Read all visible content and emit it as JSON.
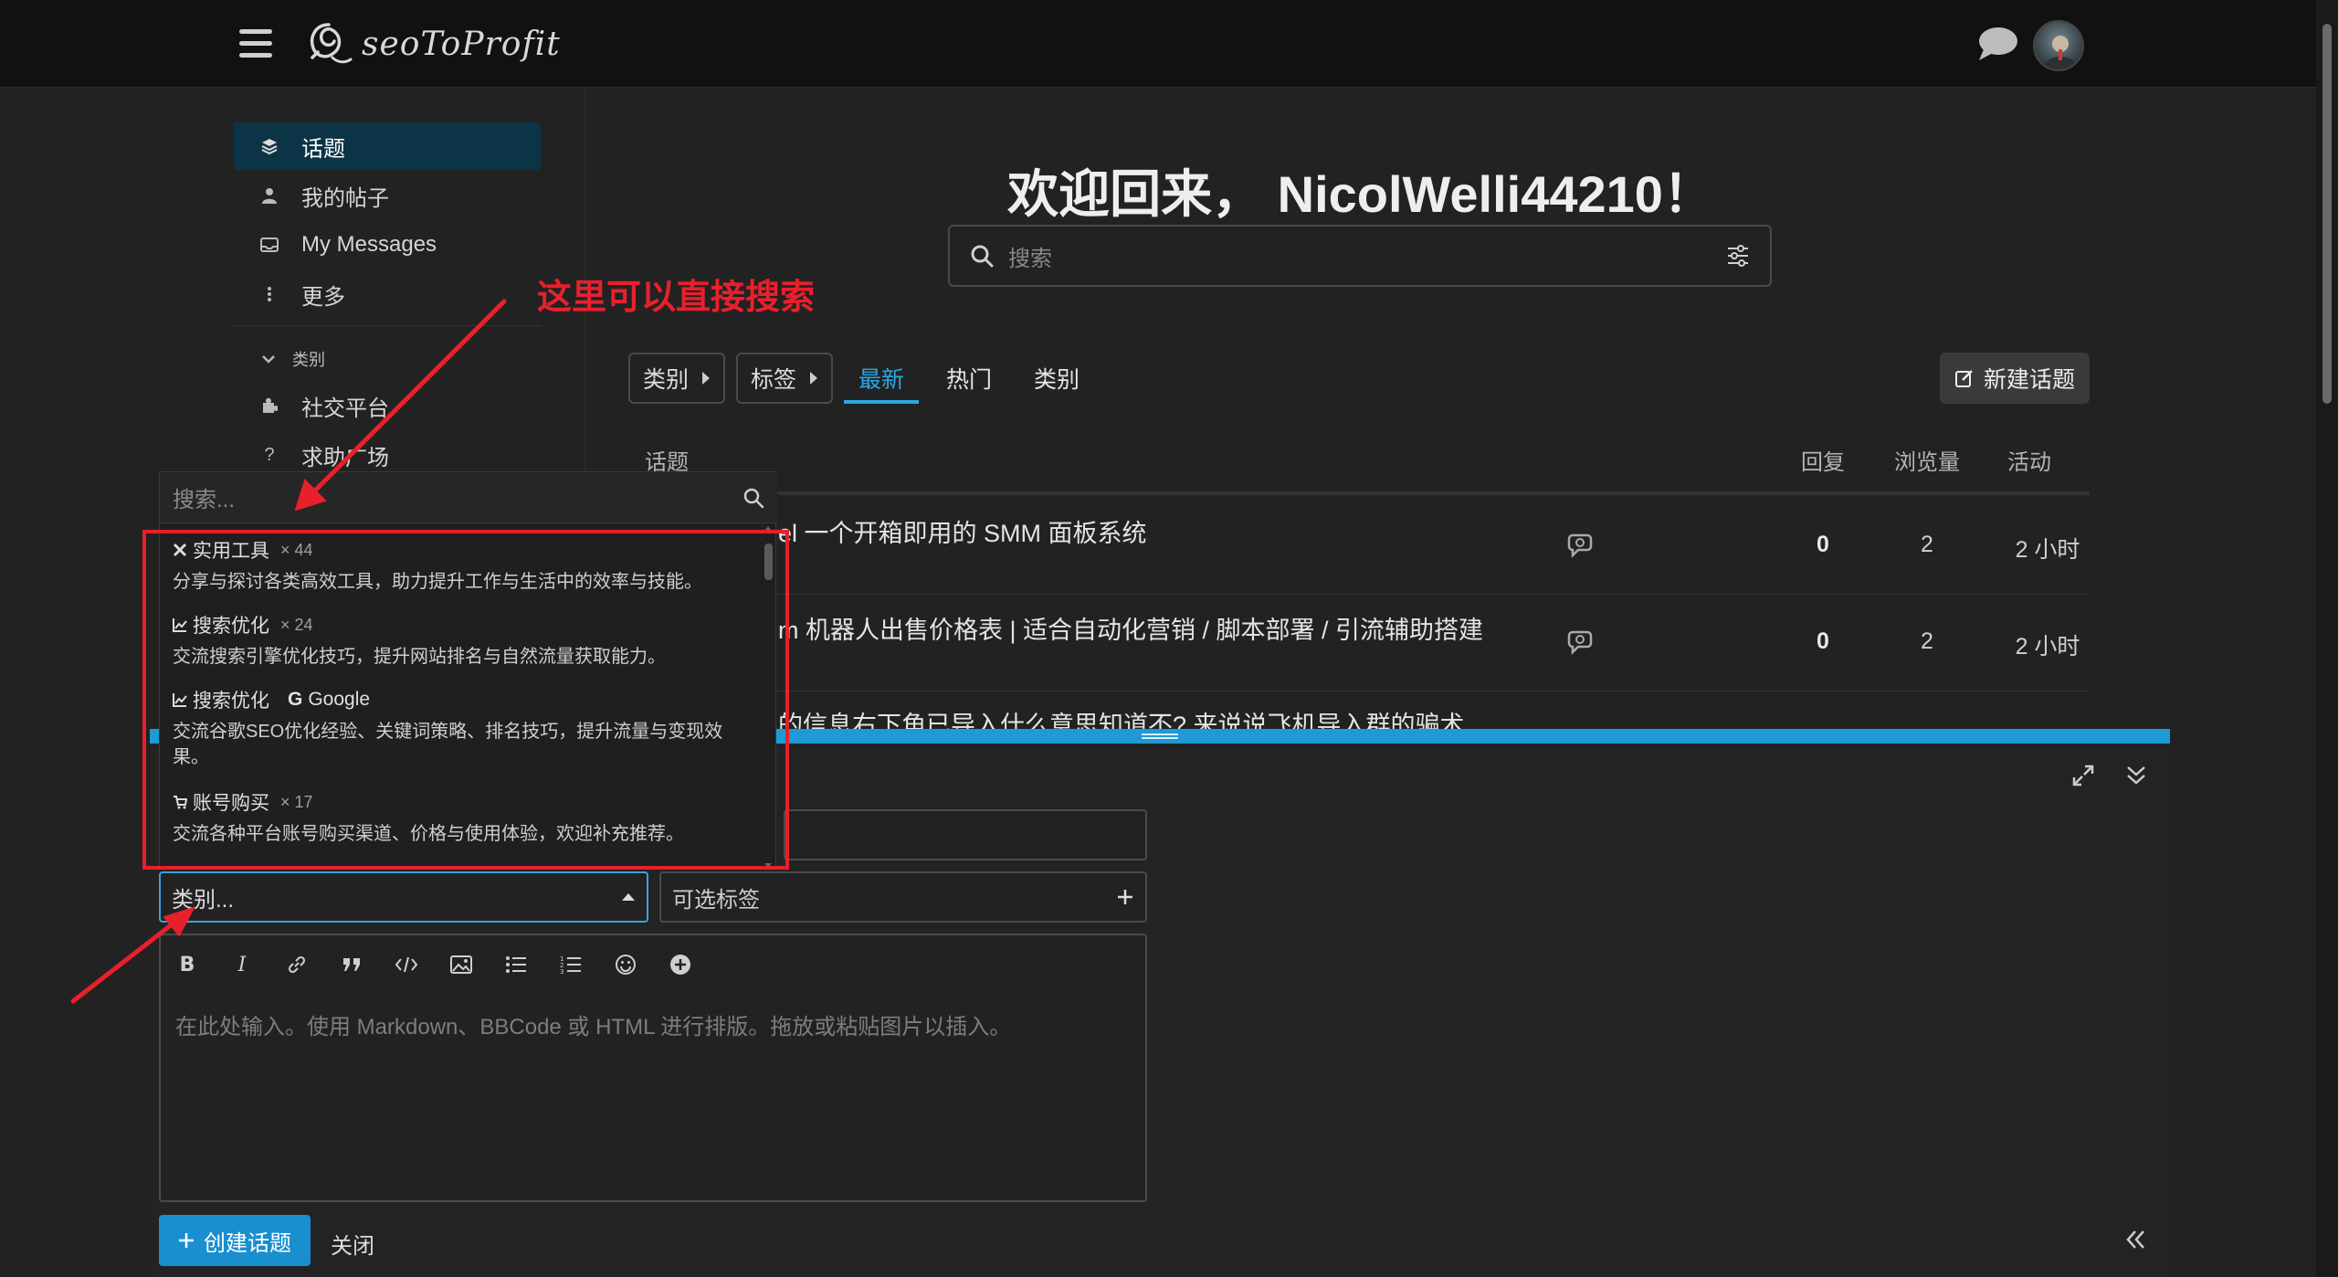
{
  "header": {
    "logo_text": "seoToProfit"
  },
  "sidebar": {
    "items": [
      {
        "label": "话题",
        "icon": "layers-icon"
      },
      {
        "label": "我的帖子",
        "icon": "user-icon"
      },
      {
        "label": "My Messages",
        "icon": "inbox-icon"
      },
      {
        "label": "更多",
        "icon": "more-vertical-icon"
      }
    ],
    "section_label": "类别",
    "categories": [
      {
        "label": "社交平台",
        "icon": "puzzle-icon"
      },
      {
        "label": "求助广场",
        "icon": "question-icon"
      }
    ]
  },
  "main": {
    "welcome": "欢迎回来， NicolWelli44210！",
    "search_placeholder": "搜索",
    "annotation": "这里可以直接搜索",
    "filters": {
      "category": "类别",
      "tags": "标签"
    },
    "tabs": [
      {
        "label": "最新",
        "active": true
      },
      {
        "label": "热门",
        "active": false
      },
      {
        "label": "类别",
        "active": false
      }
    ],
    "new_topic": "新建话题",
    "columns": {
      "topic": "话题",
      "replies": "回复",
      "views": "浏览量",
      "activity": "活动"
    },
    "topics": [
      {
        "title": "el 一个开箱即用的 SMM 面板系统",
        "replies": "0",
        "views": "2",
        "activity": "2 小时"
      },
      {
        "title": "m 机器人出售价格表 | 适合自动化营销 / 脚本部署 / 引流辅助搭建",
        "replies": "0",
        "views": "2",
        "activity": "2 小时"
      },
      {
        "title": "的信息右下角已导入什么意思知道不? 来说说飞机导入群的骗术",
        "replies": "",
        "views": "",
        "activity": ""
      }
    ]
  },
  "composer": {
    "category_placeholder": "类别...",
    "tags_placeholder": "可选标签",
    "editor_placeholder": "在此处输入。使用 Markdown、BBCode 或 HTML 进行排版。拖放或粘贴图片以插入。",
    "create_label": "创建话题",
    "close_label": "关闭",
    "dropdown": {
      "search_placeholder": "搜索...",
      "items": [
        {
          "name": "实用工具",
          "count": "× 44",
          "desc": "分享与探讨各类高效工具，助力提升工作与生活中的效率与技能。",
          "icon": "tools-icon"
        },
        {
          "name": "搜索优化",
          "count": "× 24",
          "desc": "交流搜索引擎优化技巧，提升网站排名与自然流量获取能力。",
          "icon": "chart-icon"
        },
        {
          "name": "搜索优化",
          "parent": "Google",
          "count": "",
          "desc": "交流谷歌SEO优化经验、关键词策略、排名技巧，提升流量与变现效果。",
          "icon": "chart-icon"
        },
        {
          "name": "账号购买",
          "count": "× 17",
          "desc": "交流各种平台账号购买渠道、价格与使用体验，欢迎补充推荐。",
          "icon": "cart-icon"
        }
      ]
    }
  },
  "colors": {
    "accent": "#1e9ad6",
    "annotation_red": "#e8202c",
    "background": "#222222",
    "header": "#111111"
  }
}
